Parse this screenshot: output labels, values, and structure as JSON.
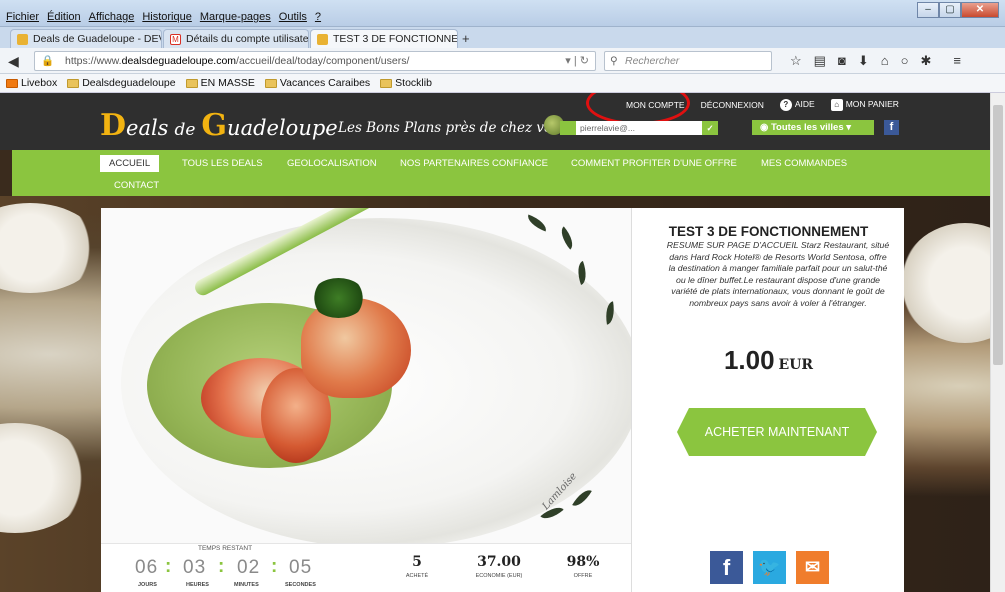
{
  "browser": {
    "menu": [
      "Fichier",
      "Édition",
      "Affichage",
      "Historique",
      "Marque-pages",
      "Outils",
      "?"
    ],
    "tabs": [
      {
        "label": "Deals de Guadeloupe - DEV...",
        "icon_color": "#e9b233",
        "active": false
      },
      {
        "label": "Détails du compte utilisate...",
        "icon_color": "#d93025",
        "active": false
      },
      {
        "label": "TEST 3 DE FONCTIONNEM...",
        "icon_color": "#e9b233",
        "active": true
      }
    ],
    "new_tab": "+",
    "url_prefix": "https://www.",
    "url_domain": "dealsdeguadeloupe.com",
    "url_path": "/accueil/deal/today/component/users/",
    "search_placeholder": "Rechercher",
    "bookmarks": [
      "Livebox",
      "Dealsdeguadeloupe",
      "EN MASSE",
      "Vacances Caraibes",
      "Stocklib"
    ]
  },
  "site": {
    "logo_big_1": "D",
    "logo_word_1": "eals",
    "logo_de": "de",
    "logo_big_2": "G",
    "logo_word_2": "uadeloupe",
    "tagline": "Les Bons Plans près de chez vous",
    "top_links": {
      "account": "MON COMPTE",
      "logout": "DÉCONNEXION",
      "help": "AIDE",
      "cart": "MON PANIER"
    },
    "newsletter_value": "pierrelavie@...",
    "cities_label": "Toutes les villes",
    "nav": [
      "ACCUEIL",
      "TOUS LES DEALS",
      "GEOLOCALISATION",
      "NOS PARTENAIRES CONFIANCE",
      "COMMENT PROFITER D'UNE OFFRE",
      "MES COMMANDES",
      "CONTACT"
    ],
    "image_signature": "Lamloise",
    "countdown": {
      "title": "TEMPS RESTANT",
      "days": "06",
      "hours": "03",
      "minutes": "02",
      "seconds": "05",
      "days_label": "JOURS",
      "hours_label": "HEURES",
      "minutes_label": "MINUTES",
      "seconds_label": "SECONDES"
    },
    "stats": {
      "bought": "5",
      "bought_label": "ACHETÉ",
      "savings": "37.00",
      "savings_label": "ECONOMIE (EUR)",
      "discount": "98%",
      "discount_label": "OFFRE"
    },
    "deal": {
      "title": "TEST 3 DE FONCTIONNEMENT",
      "description": "RESUME SUR PAGE D'ACCUEIL Starz Restaurant, situé dans Hard Rock Hotel® de Resorts World Sentosa, offre la destination à manger familiale parfait pour un salut-thé ou le dîner buffet.Le restaurant dispose d'une grande variété de plats internationaux, vous donnant le goût de nombreux pays sans avoir à voler à l'étranger.",
      "price": "1.00",
      "currency": "EUR",
      "buy_label": "ACHETER MAINTENANT"
    }
  }
}
